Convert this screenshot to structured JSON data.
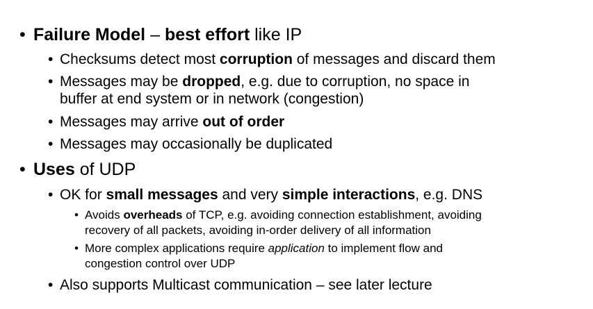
{
  "bullet_char": "•",
  "items": [
    {
      "level": 1,
      "runs": [
        {
          "t": "Failure Model",
          "s": "b"
        },
        {
          "t": " – ",
          "s": ""
        },
        {
          "t": "best effort",
          "s": "b"
        },
        {
          "t": " like IP",
          "s": ""
        }
      ]
    },
    {
      "level": 2,
      "runs": [
        {
          "t": "Checksums detect most ",
          "s": ""
        },
        {
          "t": "corruption",
          "s": "b"
        },
        {
          "t": " of messages and discard them",
          "s": ""
        }
      ]
    },
    {
      "level": 2,
      "runs": [
        {
          "t": "Messages may be ",
          "s": ""
        },
        {
          "t": "dropped",
          "s": "b"
        },
        {
          "t": ", e.g. due to corruption, no space in",
          "s": ""
        }
      ],
      "runs2": [
        {
          "t": "buffer at end system or in network (congestion)",
          "s": ""
        }
      ]
    },
    {
      "level": 2,
      "runs": [
        {
          "t": "Messages may arrive ",
          "s": ""
        },
        {
          "t": "out of order",
          "s": "b"
        }
      ]
    },
    {
      "level": 2,
      "runs": [
        {
          "t": "Messages may occasionally be duplicated",
          "s": ""
        }
      ]
    },
    {
      "level": 1,
      "runs": [
        {
          "t": "Uses",
          "s": "b"
        },
        {
          "t": " of UDP",
          "s": ""
        }
      ]
    },
    {
      "level": 2,
      "runs": [
        {
          "t": "OK for ",
          "s": ""
        },
        {
          "t": "small messages",
          "s": "b"
        },
        {
          "t": " and very ",
          "s": ""
        },
        {
          "t": "simple interactions",
          "s": "b"
        },
        {
          "t": ", e.g. DNS",
          "s": ""
        }
      ]
    },
    {
      "level": 3,
      "runs": [
        {
          "t": "Avoids ",
          "s": ""
        },
        {
          "t": "overheads",
          "s": "b"
        },
        {
          "t": " of TCP, e.g. avoiding connection establishment, avoiding",
          "s": ""
        }
      ],
      "runs2": [
        {
          "t": "recovery of all packets, avoiding in-order delivery of all information",
          "s": ""
        }
      ]
    },
    {
      "level": 3,
      "runs": [
        {
          "t": "More complex applications require ",
          "s": ""
        },
        {
          "t": "application",
          "s": "i"
        },
        {
          "t": " to implement flow and",
          "s": ""
        }
      ],
      "runs2": [
        {
          "t": "congestion control over UDP",
          "s": ""
        }
      ]
    },
    {
      "level": 2,
      "runs": [
        {
          "t": "Also supports Multicast communication – see later lecture",
          "s": ""
        }
      ]
    }
  ]
}
